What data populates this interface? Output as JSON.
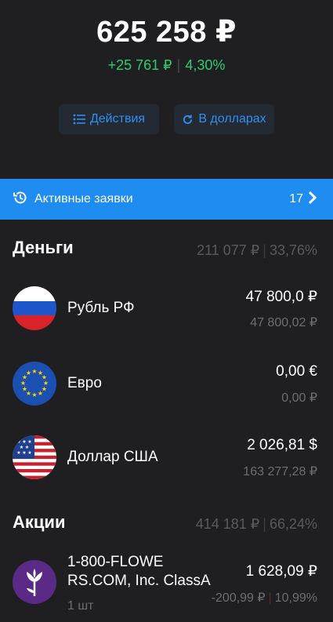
{
  "portfolio": {
    "total": "625 258 ₽",
    "change_abs": "+25 761 ₽",
    "change_pct": "4,30%",
    "separator": "|"
  },
  "buttons": {
    "actions_label": "Действия",
    "usd_label": "В долларах"
  },
  "active_orders": {
    "label": "Активные заявки",
    "count": "17"
  },
  "money": {
    "title": "Деньги",
    "sum": "211 077 ₽",
    "pct": "33,76%",
    "items": [
      {
        "name": "Рубль РФ",
        "value": "47 800,0 ₽",
        "sub": "47 800,02 ₽",
        "icon": "russia-flag-icon"
      },
      {
        "name": "Евро",
        "value": "0,00 €",
        "sub": "0,00 ₽",
        "icon": "eu-flag-icon"
      },
      {
        "name": "Доллар США",
        "value": "2 026,81 $",
        "sub": "163 277,28 ₽",
        "icon": "usa-flag-icon"
      }
    ]
  },
  "stocks": {
    "title": "Акции",
    "sum": "414 181 ₽",
    "pct": "66,24%",
    "items": [
      {
        "name_line1": "1-800-FLOWE",
        "name_line2": "RS.COM, Inc. ClassA",
        "qty": "1 шт",
        "value": "1 628,09 ₽",
        "change_abs": "-200,99 ₽",
        "change_pct": "10,99%",
        "icon": "flowers-logo-icon"
      }
    ]
  },
  "colors": {
    "background": "#1f1f21",
    "accent": "#1e8cf0",
    "positive": "#2ecc71",
    "negative": "#e5484d",
    "logo_purple": "#5b2a86"
  }
}
